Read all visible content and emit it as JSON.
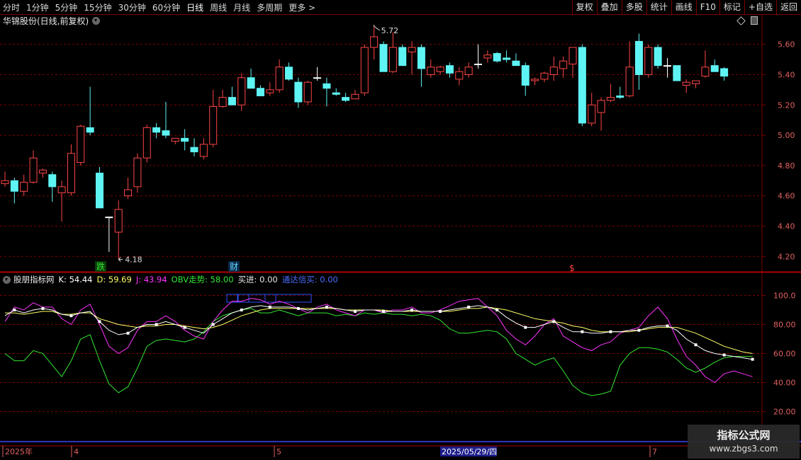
{
  "toolbar": {
    "periods": [
      "分时",
      "1分钟",
      "5分钟",
      "15分钟",
      "30分钟",
      "60分钟",
      "日线",
      "周线",
      "月线",
      "多周期",
      "更多 >"
    ],
    "active": "日线",
    "buttons": [
      "复权",
      "叠加",
      "多股",
      "统计",
      "画线",
      "F10",
      "标记",
      "+自选",
      "返回"
    ]
  },
  "stock_title": "华锦股份(日线,前复权)",
  "indicator": {
    "name": "股朋指标网",
    "K_label": "K: 54.44",
    "D_label": "D: 59.69",
    "J_label": "J: 43.94",
    "OBV_label": "OBV走势: 58.00",
    "buy_label": "买进: 0.00",
    "signal_label": "通达信买: 0.00"
  },
  "colors": {
    "up": "#ff4545",
    "down": "#5ef4f4",
    "k": "#ffffff",
    "d": "#ffff66",
    "j": "#ff33ff",
    "obv": "#33e833",
    "grid": "#7a0000",
    "axis_text": "#e06060"
  },
  "markers": {
    "high_label": "5.72",
    "low_label": "4.18",
    "event1": "跌",
    "event2": "财",
    "event3": "$"
  },
  "bottom_axis": {
    "labels": [
      "2025年",
      "4",
      "5",
      "7"
    ],
    "highlight": "2025/05/29/四"
  },
  "watermark": {
    "line1": "指标公式网",
    "line2": "www.zbgs3.com"
  },
  "chart_data": [
    {
      "type": "candlestick",
      "ylim": [
        4.15,
        5.72
      ],
      "yticks": [
        "5.60",
        "5.40",
        "5.20",
        "5.00",
        "4.80",
        "4.60",
        "4.40",
        "4.20"
      ],
      "ohlc": [
        [
          4.68,
          4.76,
          4.66,
          4.7
        ],
        [
          4.7,
          4.72,
          4.55,
          4.63
        ],
        [
          4.63,
          4.74,
          4.6,
          4.69
        ],
        [
          4.69,
          4.9,
          4.68,
          4.85
        ],
        [
          4.75,
          4.78,
          4.72,
          4.77
        ],
        [
          4.74,
          4.76,
          4.56,
          4.66
        ],
        [
          4.62,
          4.7,
          4.43,
          4.66
        ],
        [
          4.62,
          4.94,
          4.6,
          4.88
        ],
        [
          4.82,
          5.07,
          4.8,
          5.06
        ],
        [
          5.05,
          5.32,
          5.0,
          5.02
        ],
        [
          4.75,
          4.79,
          4.52,
          4.52
        ],
        [
          4.46,
          4.46,
          4.23,
          4.46
        ],
        [
          4.36,
          4.57,
          4.18,
          4.51
        ],
        [
          4.6,
          4.72,
          4.58,
          4.64
        ],
        [
          4.66,
          4.88,
          4.62,
          4.85
        ],
        [
          4.85,
          5.07,
          4.82,
          5.05
        ],
        [
          5.05,
          5.08,
          4.98,
          5.02
        ],
        [
          5.03,
          5.22,
          4.98,
          5.0
        ],
        [
          4.96,
          4.98,
          4.94,
          4.98
        ],
        [
          4.98,
          5.04,
          4.9,
          4.96
        ],
        [
          4.92,
          4.98,
          4.86,
          4.89
        ],
        [
          4.86,
          4.98,
          4.84,
          4.94
        ],
        [
          4.94,
          5.3,
          4.92,
          5.19
        ],
        [
          5.19,
          5.3,
          5.18,
          5.25
        ],
        [
          5.25,
          5.32,
          5.22,
          5.2
        ],
        [
          5.2,
          5.41,
          5.16,
          5.38
        ],
        [
          5.38,
          5.44,
          5.34,
          5.31
        ],
        [
          5.31,
          5.33,
          5.26,
          5.26
        ],
        [
          5.28,
          5.35,
          5.26,
          5.3
        ],
        [
          5.3,
          5.5,
          5.28,
          5.45
        ],
        [
          5.45,
          5.48,
          5.36,
          5.37
        ],
        [
          5.35,
          5.38,
          5.18,
          5.22
        ],
        [
          5.22,
          5.36,
          5.2,
          5.35
        ],
        [
          5.38,
          5.45,
          5.36,
          5.38
        ],
        [
          5.34,
          5.38,
          5.19,
          5.31
        ],
        [
          5.28,
          5.31,
          5.26,
          5.27
        ],
        [
          5.25,
          5.28,
          5.22,
          5.23
        ],
        [
          5.24,
          5.3,
          5.24,
          5.27
        ],
        [
          5.28,
          5.6,
          5.26,
          5.58
        ],
        [
          5.58,
          5.72,
          5.5,
          5.65
        ],
        [
          5.6,
          5.62,
          5.42,
          5.42
        ],
        [
          5.42,
          5.68,
          5.41,
          5.58
        ],
        [
          5.58,
          5.6,
          5.46,
          5.46
        ],
        [
          5.55,
          5.62,
          5.4,
          5.58
        ],
        [
          5.58,
          5.6,
          5.32,
          5.44
        ],
        [
          5.4,
          5.5,
          5.38,
          5.45
        ],
        [
          5.42,
          5.46,
          5.4,
          5.45
        ],
        [
          5.46,
          5.48,
          5.38,
          5.41
        ],
        [
          5.37,
          5.45,
          5.33,
          5.42
        ],
        [
          5.4,
          5.48,
          5.38,
          5.45
        ],
        [
          5.47,
          5.6,
          5.44,
          5.47
        ],
        [
          5.51,
          5.56,
          5.48,
          5.53
        ],
        [
          5.54,
          5.55,
          5.48,
          5.49
        ],
        [
          5.51,
          5.56,
          5.48,
          5.5
        ],
        [
          5.49,
          5.54,
          5.46,
          5.46
        ],
        [
          5.46,
          5.48,
          5.26,
          5.33
        ],
        [
          5.36,
          5.38,
          5.33,
          5.37
        ],
        [
          5.37,
          5.42,
          5.35,
          5.41
        ],
        [
          5.4,
          5.52,
          5.36,
          5.45
        ],
        [
          5.44,
          5.52,
          5.38,
          5.49
        ],
        [
          5.47,
          5.57,
          5.38,
          5.58
        ],
        [
          5.58,
          5.6,
          5.06,
          5.08
        ],
        [
          5.08,
          5.28,
          5.06,
          5.2
        ],
        [
          5.15,
          5.25,
          5.03,
          5.23
        ],
        [
          5.23,
          5.34,
          5.22,
          5.25
        ],
        [
          5.26,
          5.32,
          5.24,
          5.25
        ],
        [
          5.26,
          5.62,
          5.25,
          5.45
        ],
        [
          5.62,
          5.67,
          5.3,
          5.4
        ],
        [
          5.4,
          5.6,
          5.38,
          5.58
        ],
        [
          5.58,
          5.6,
          5.44,
          5.46
        ],
        [
          5.46,
          5.51,
          5.38,
          5.46
        ],
        [
          5.46,
          5.46,
          5.36,
          5.36
        ],
        [
          5.33,
          5.37,
          5.28,
          5.35
        ],
        [
          5.34,
          5.36,
          5.31,
          5.36
        ],
        [
          5.39,
          5.56,
          5.38,
          5.45
        ],
        [
          5.46,
          5.5,
          5.44,
          5.42
        ],
        [
          5.44,
          5.45,
          5.36,
          5.39
        ]
      ]
    },
    {
      "type": "line",
      "ylim": [
        10,
        110
      ],
      "yticks": [
        "100.0",
        "80.00",
        "60.00",
        "40.00",
        "20.00"
      ],
      "series": [
        {
          "name": "K",
          "values": [
            86,
            90,
            88,
            90,
            91,
            90,
            87,
            86,
            88,
            89,
            82,
            76,
            73,
            74,
            78,
            80,
            80,
            82,
            80,
            78,
            76,
            74,
            80,
            84,
            88,
            90,
            92,
            93,
            92,
            92,
            92,
            91,
            90,
            91,
            92,
            91,
            90,
            89,
            90,
            90,
            89,
            89,
            89,
            90,
            89,
            89,
            89,
            90,
            91,
            92,
            93,
            92,
            90,
            85,
            81,
            78,
            78,
            80,
            82,
            78,
            75,
            75,
            74,
            74,
            75,
            75,
            76,
            76,
            78,
            79,
            79,
            76,
            70,
            66,
            62,
            60,
            59,
            58,
            57,
            56
          ]
        },
        {
          "name": "D",
          "values": [
            88,
            88,
            87,
            88,
            89,
            89,
            87,
            87,
            88,
            88,
            84,
            82,
            80,
            79,
            78,
            79,
            79,
            80,
            80,
            79,
            78,
            77,
            78,
            80,
            83,
            86,
            88,
            90,
            91,
            91,
            91,
            91,
            91,
            91,
            91,
            91,
            90,
            90,
            90,
            90,
            90,
            89,
            89,
            89,
            89,
            89,
            89,
            89,
            90,
            91,
            91,
            92,
            91,
            90,
            88,
            86,
            84,
            83,
            82,
            81,
            79,
            78,
            76,
            75,
            75,
            75,
            75,
            76,
            77,
            78,
            78,
            78,
            76,
            74,
            71,
            68,
            65,
            63,
            61,
            60
          ]
        },
        {
          "name": "J",
          "values": [
            82,
            92,
            90,
            95,
            92,
            92,
            84,
            80,
            90,
            94,
            80,
            65,
            60,
            64,
            76,
            82,
            82,
            86,
            82,
            76,
            72,
            70,
            82,
            90,
            96,
            96,
            98,
            97,
            94,
            96,
            94,
            91,
            88,
            92,
            94,
            90,
            88,
            86,
            90,
            90,
            88,
            90,
            90,
            92,
            88,
            88,
            90,
            93,
            96,
            97,
            98,
            92,
            86,
            76,
            70,
            66,
            72,
            80,
            84,
            72,
            68,
            64,
            62,
            66,
            68,
            74,
            76,
            78,
            86,
            92,
            84,
            70,
            58,
            52,
            44,
            40,
            46,
            48,
            46,
            44
          ]
        },
        {
          "name": "OBV",
          "values": [
            60,
            55,
            55,
            62,
            60,
            52,
            44,
            55,
            70,
            73,
            55,
            39,
            33,
            37,
            50,
            65,
            69,
            70,
            69,
            68,
            70,
            75,
            82,
            86,
            88,
            90,
            91,
            88,
            88,
            90,
            88,
            86,
            88,
            88,
            88,
            86,
            87,
            86,
            88,
            87,
            88,
            87,
            87,
            86,
            87,
            86,
            83,
            77,
            74,
            74,
            75,
            76,
            75,
            70,
            60,
            56,
            52,
            55,
            57,
            48,
            38,
            33,
            31,
            32,
            34,
            52,
            60,
            64,
            64,
            63,
            61,
            56,
            50,
            47,
            50,
            54,
            57,
            58,
            58,
            58
          ]
        }
      ]
    }
  ]
}
